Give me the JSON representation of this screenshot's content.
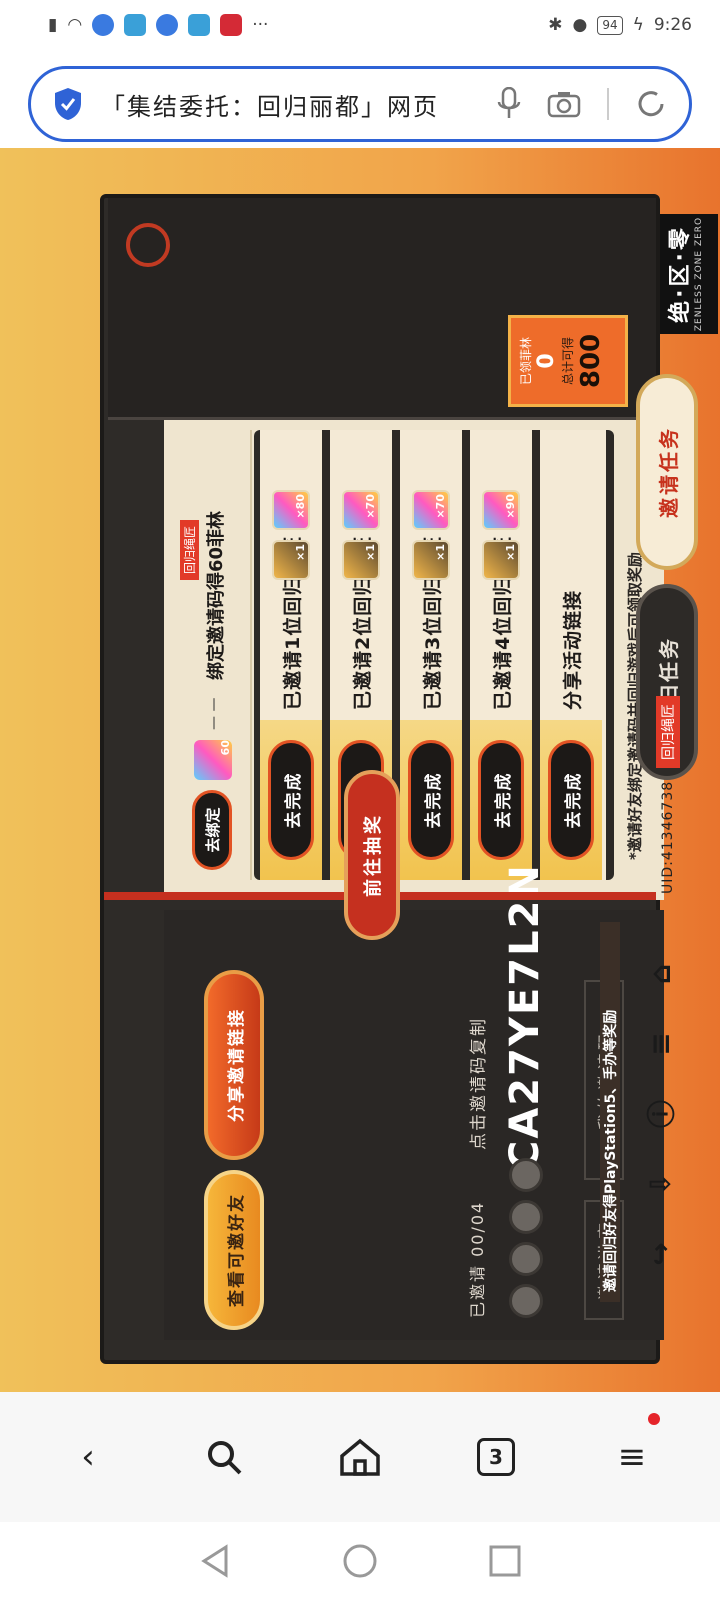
{
  "status": {
    "battery": "94",
    "time": "9:26",
    "more": "···"
  },
  "browser": {
    "url_title": "「集结委托：回归丽都」网页"
  },
  "page": {
    "logo_main": "绝·区·零",
    "logo_sub": "ZENLESS ZONE ZERO",
    "earned_label": "已领菲林",
    "earned_value": "0",
    "total_label": "总计可得",
    "total_value": "800",
    "tab_invite": "邀请任务",
    "tab_return": "回归任务",
    "user_tag": "回归绳匠",
    "uid": "UID:41346738",
    "tasks": [
      {
        "label": "已邀请1位回归绳匠",
        "film": "×80",
        "ticket": "×1",
        "button": "去完成"
      },
      {
        "label": "已邀请2位回归绳匠",
        "film": "×70",
        "ticket": "×1",
        "button": "去完成"
      },
      {
        "label": "已邀请3位回归绳匠",
        "film": "×70",
        "ticket": "×1",
        "button": "去完成"
      },
      {
        "label": "已邀请4位回归绳匠",
        "film": "×90",
        "ticket": "×1",
        "button": "去完成"
      },
      {
        "label": "分享活动链接",
        "film": "",
        "ticket": "",
        "button": "去完成"
      }
    ],
    "bind_tag": "回归绳匠",
    "bind_label": "绑定邀请码得60菲林",
    "bind_progress": "— —",
    "bind_reward": "60",
    "bind_button": "去绑定",
    "note": "*邀请好友绑定邀请码并回归游戏后可领取奖励",
    "prize_title": "邀请回归好友得PlayStation5、手办等奖励",
    "draw_button": "前往抽奖",
    "mycode_label": "我的邀请码",
    "record_label": "邀请进度",
    "invite_code": "CA27YE7L2N",
    "copy_hint": "点击邀请码复制",
    "invited_count": "已邀请 00/04",
    "share_button": "分享邀请链接",
    "friends_button": "查看可邀好友"
  },
  "nav": {
    "tabs": "3"
  }
}
